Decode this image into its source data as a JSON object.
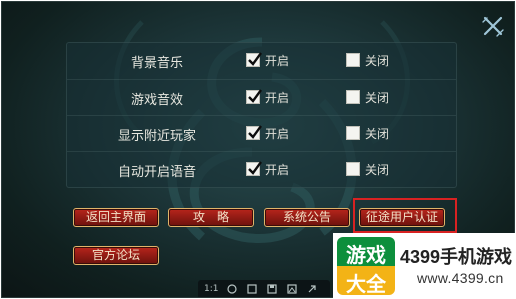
{
  "settings": [
    {
      "label": "背景音乐",
      "on_label": "开启",
      "off_label": "关闭",
      "on": true
    },
    {
      "label": "游戏音效",
      "on_label": "开启",
      "off_label": "关闭",
      "on": true
    },
    {
      "label": "显示附近玩家",
      "on_label": "开启",
      "off_label": "关闭",
      "on": true
    },
    {
      "label": "自动开启语音",
      "on_label": "开启",
      "off_label": "关闭",
      "on": true
    }
  ],
  "buttons": {
    "home": "返回主界面",
    "strategy": "攻略",
    "notice": "系统公告",
    "cert": "征途用户认证",
    "forum": "官方论坛"
  },
  "toolbar": {
    "ratio": "1:1"
  },
  "watermark": {
    "mark_top": "游戏",
    "mark_bottom": "大全",
    "brand": "4399手机游戏",
    "url": "www.4399.cn"
  },
  "colors": {
    "button": "#9c1e16",
    "highlight": "#d82222",
    "logo_green": "#0d8f3c",
    "logo_yellow": "#f3b316"
  }
}
